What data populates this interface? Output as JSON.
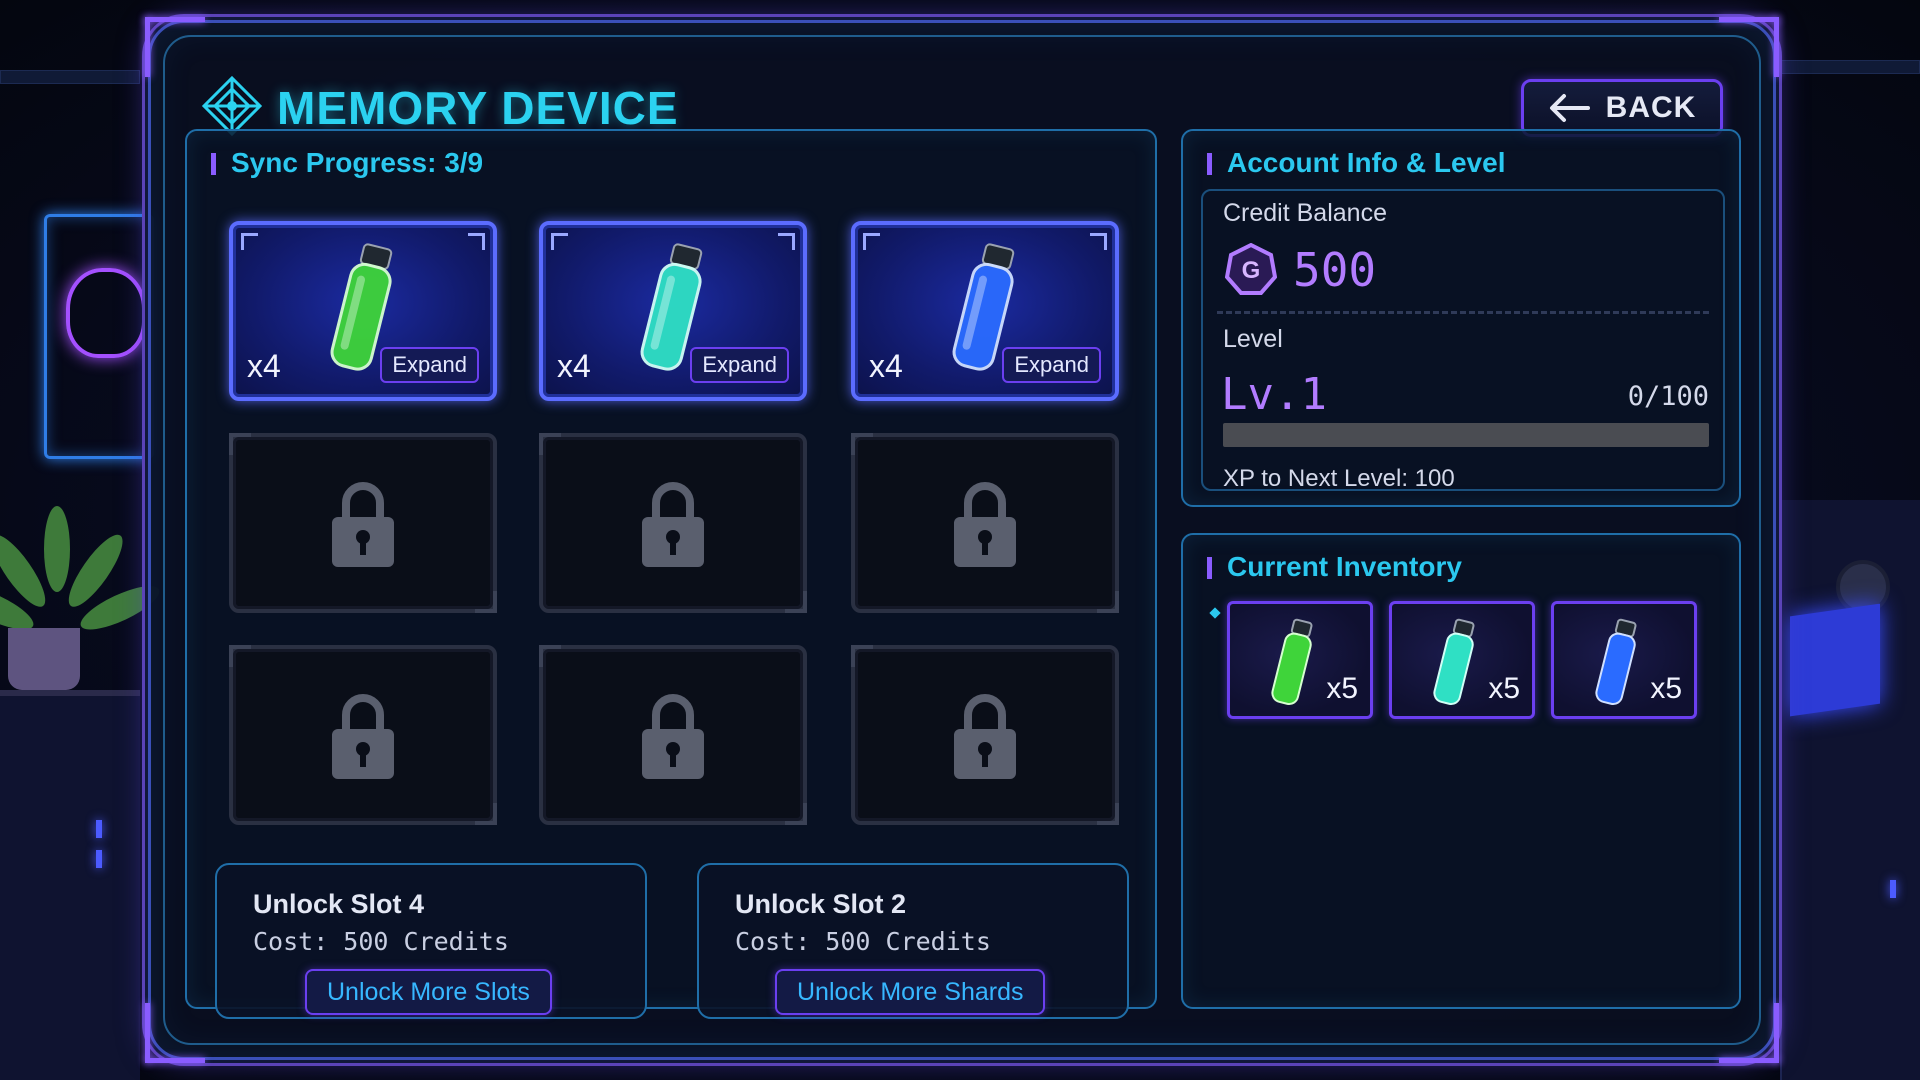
{
  "header": {
    "title": "MEMORY DEVICE",
    "back_label": "BACK"
  },
  "sync": {
    "title": "Sync Progress: 3/9",
    "slots": [
      {
        "state": "active",
        "color": "#3fd43a",
        "count": "x4",
        "action": "Expand"
      },
      {
        "state": "active",
        "color": "#2fe0c4",
        "count": "x4",
        "action": "Expand"
      },
      {
        "state": "active",
        "color": "#2a6bff",
        "count": "x4",
        "action": "Expand"
      },
      {
        "state": "locked"
      },
      {
        "state": "locked"
      },
      {
        "state": "locked"
      },
      {
        "state": "locked"
      },
      {
        "state": "locked"
      },
      {
        "state": "locked"
      }
    ],
    "unlock_cards": [
      {
        "title": "Unlock Slot 4",
        "cost": "Cost: 500 Credits",
        "button": "Unlock More Slots"
      },
      {
        "title": "Unlock Slot 2",
        "cost": "Cost: 500 Credits",
        "button": "Unlock More Shards"
      }
    ]
  },
  "account": {
    "title": "Account Info & Level",
    "credit_label": "Credit Balance",
    "credit_value": "500",
    "coin_icon": "credit-coin-icon",
    "level_label": "Level",
    "level_value": "Lv.1",
    "xp": "0/100",
    "xp_progress": 0,
    "xp_next": "XP to Next Level: 100"
  },
  "inventory": {
    "title": "Current Inventory",
    "items": [
      {
        "color": "#3fd43a",
        "count": "x5"
      },
      {
        "color": "#2fe0c4",
        "count": "x5"
      },
      {
        "color": "#2a6bff",
        "count": "x5"
      }
    ]
  },
  "colors": {
    "accent_cyan": "#2bd2f0",
    "accent_purple": "#6b3ff0",
    "level_purple": "#b27cff"
  }
}
